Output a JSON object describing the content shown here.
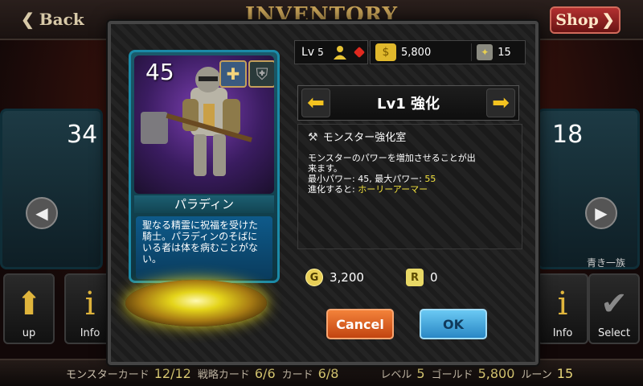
{
  "header": {
    "back_label": "Back",
    "title": "INVENTORY",
    "shop_label": "Shop"
  },
  "side": {
    "left_card_power": "34",
    "right_card_power": "18",
    "right_card_name": "青き一族",
    "left_button_label": "up",
    "info_label": "Info",
    "select_label": "Select"
  },
  "status": {
    "monster_cards_label": "モンスターカード",
    "monster_cards_value": "12/12",
    "strategy_cards_label": "戦略カード",
    "strategy_cards_value": "6/6",
    "cards_label": "カード",
    "cards_value": "6/8",
    "level_label": "レベル",
    "level_value": "5",
    "gold_label": "ゴールド",
    "gold_value": "5,800",
    "rune_label": "ルーン",
    "rune_value": "15"
  },
  "modal": {
    "card": {
      "power": "45",
      "name": "パラディン",
      "description": "聖なる精霊に祝福を受けた騎士。パラディンのそばにいる者は体を病むことがない。"
    },
    "player": {
      "lv_label": "Lv",
      "lv_value": "5",
      "gold": "5,800",
      "rune": "15"
    },
    "upgrade": {
      "title": "Lv1 強化"
    },
    "info": {
      "heading": "モンスター強化室",
      "line1": "モンスターのパワーを増加させることが出",
      "line2": "来ます。",
      "line3_prefix": "最小パワー: 45, 最大パワー: ",
      "max_power": "55",
      "line4_prefix": "進化すると: ",
      "evolution": "ホーリーアーマー"
    },
    "cost": {
      "gold_icon": "G",
      "gold": "3,200",
      "rune_icon": "R",
      "rune": "0"
    },
    "buttons": {
      "cancel": "Cancel",
      "ok": "OK"
    }
  }
}
